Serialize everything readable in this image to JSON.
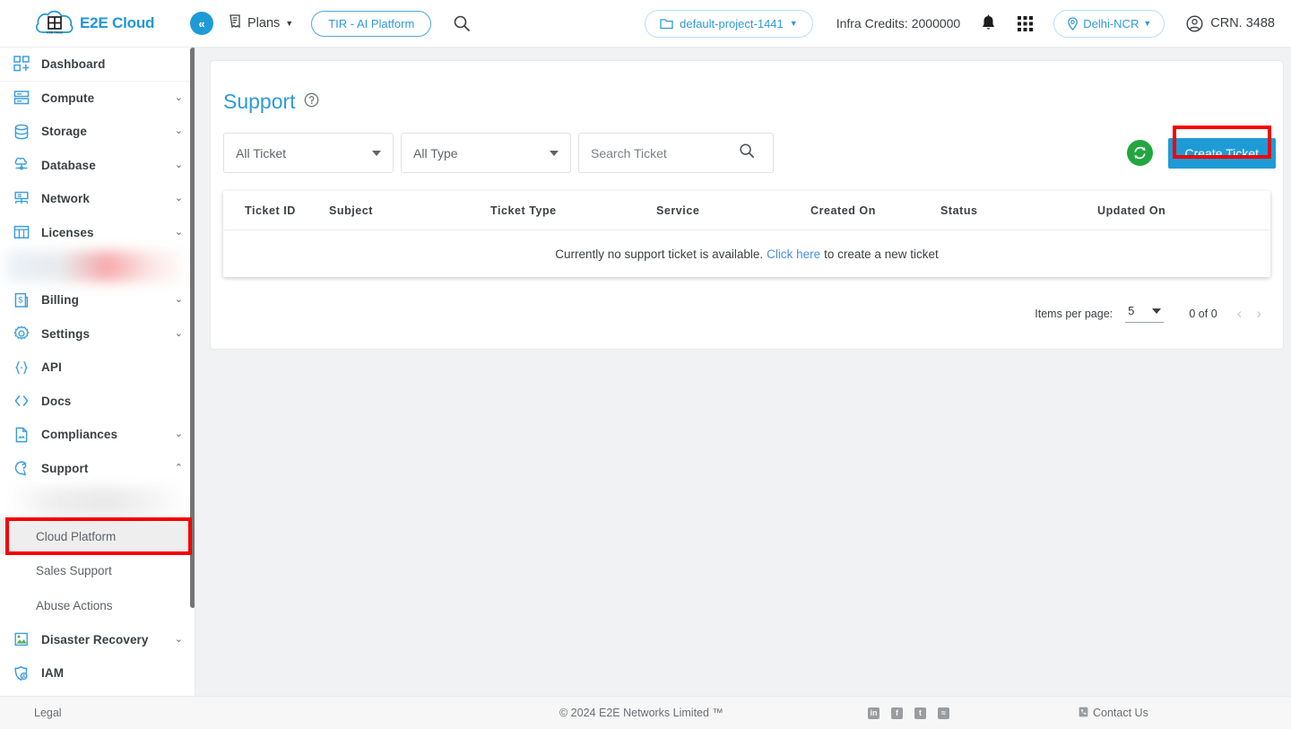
{
  "header": {
    "logo_text": "E2E Cloud",
    "logo_badge": "E2E Cloud",
    "collapse_label": "«",
    "plans_label": "Plans",
    "tir_label": "TIR - AI Platform",
    "project_label": "default-project-1441",
    "credits_label": "Infra Credits: 2000000",
    "region_label": "Delhi-NCR",
    "crn_label": "CRN. 3488"
  },
  "sidebar": {
    "items": [
      {
        "label": "Dashboard",
        "icon": "dashboard-icon",
        "expandable": false,
        "separator": true
      },
      {
        "label": "Compute",
        "icon": "server-icon",
        "expandable": true,
        "separator": false
      },
      {
        "label": "Storage",
        "icon": "database-stack-icon",
        "expandable": true,
        "separator": false
      },
      {
        "label": "Database",
        "icon": "database-cloud-icon",
        "expandable": true,
        "separator": false
      },
      {
        "label": "Network",
        "icon": "network-icon",
        "expandable": true,
        "separator": false
      },
      {
        "label": "Licenses",
        "icon": "grid-license-icon",
        "expandable": true,
        "separator": false
      },
      {
        "label": "Billing",
        "icon": "billing-icon",
        "expandable": true,
        "separator": false
      },
      {
        "label": "Settings",
        "icon": "gear-icon",
        "expandable": true,
        "separator": false
      },
      {
        "label": "API",
        "icon": "braces-icon",
        "expandable": false,
        "separator": false
      },
      {
        "label": "Docs",
        "icon": "code-brackets-icon",
        "expandable": false,
        "separator": false
      },
      {
        "label": "Compliances",
        "icon": "document-icon",
        "expandable": true,
        "separator": false
      },
      {
        "label": "Support",
        "icon": "support-icon",
        "expandable": true,
        "expanded": true,
        "separator": false
      }
    ],
    "support_children": [
      {
        "label": "Cloud Platform",
        "active": true
      },
      {
        "label": "Sales Support",
        "active": false
      },
      {
        "label": "Abuse Actions",
        "active": false
      }
    ],
    "bottom_items": [
      {
        "label": "Disaster Recovery",
        "icon": "disaster-recovery-icon",
        "expandable": true
      },
      {
        "label": "IAM",
        "icon": "iam-shield-icon",
        "expandable": false
      }
    ]
  },
  "main": {
    "page_title": "Support",
    "help_icon": "help-circle-icon",
    "filters": {
      "ticket_filter": "All Ticket",
      "type_filter": "All Type",
      "search_placeholder": "Search Ticket",
      "search_value": ""
    },
    "refresh_label": "refresh-icon",
    "create_button": "Create Ticket",
    "table": {
      "columns": [
        "Ticket ID",
        "Subject",
        "Ticket Type",
        "Service",
        "Created On",
        "Status",
        "Updated On"
      ],
      "rows": [],
      "empty_prefix": "Currently no support ticket is available.",
      "empty_link": "Click here",
      "empty_suffix": "to create a new ticket"
    },
    "pagination": {
      "items_per_page_label": "Items per page:",
      "items_per_page_value": "5",
      "range_label": "0 of 0",
      "prev_icon": "chevron-left-icon",
      "next_icon": "chevron-right-icon"
    }
  },
  "footer": {
    "legal": "Legal",
    "copyright_symbol": "© 2024",
    "company": "E2E Networks Limited ™",
    "socials": [
      "linkedin-icon",
      "facebook-icon",
      "twitter-icon",
      "rss-icon"
    ],
    "contact": "Contact Us"
  },
  "colors": {
    "brand_blue": "#2196d6",
    "button_blue": "#1e9bd7",
    "accent_green": "#22a63f",
    "highlight_red": "#f50000",
    "link_blue": "#4a90e2",
    "page_bg": "#f1f2f3"
  }
}
